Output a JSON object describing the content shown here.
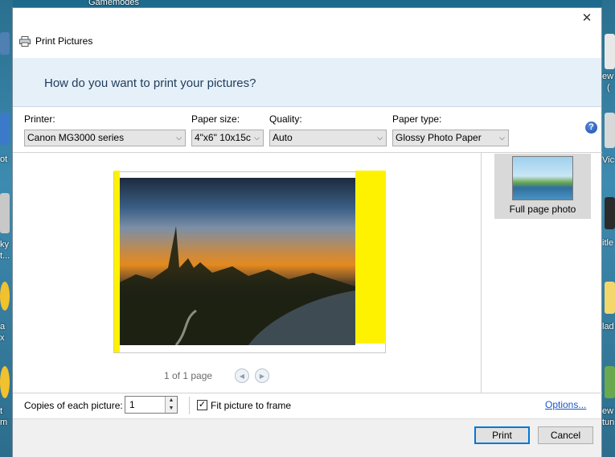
{
  "desktop": {
    "top_label": "Gamemodes",
    "left_labels": [
      "ot",
      "ky",
      "t...",
      "a",
      "x",
      "t",
      "m"
    ],
    "right_labels": [
      "ew",
      "(",
      "Vic",
      "itle",
      "lad",
      "ew",
      "tun"
    ]
  },
  "dialog": {
    "title": "Print Pictures",
    "close_glyph": "✕",
    "question": "How do you want to print your pictures?",
    "printer": {
      "label": "Printer:",
      "value": "Canon MG3000 series"
    },
    "paper_size": {
      "label": "Paper size:",
      "value": "4\"x6\" 10x15c"
    },
    "quality": {
      "label": "Quality:",
      "value": "Auto"
    },
    "paper_type": {
      "label": "Paper type:",
      "value": "Glossy Photo Paper"
    },
    "help_glyph": "?",
    "page_indicator": "1 of 1 page",
    "prev_glyph": "◀",
    "next_glyph": "▶",
    "layout_option": "Full page photo",
    "copies_label": "Copies of each picture:",
    "copies_value": "1",
    "spin_up": "▲",
    "spin_down": "▼",
    "fit_label": "Fit picture to frame",
    "fit_checked": "✓",
    "options_link": "Options...",
    "print_button": "Print",
    "cancel_button": "Cancel",
    "combo_arrow": "⌵"
  },
  "colors": {
    "banner": "#e6f0f9",
    "highlight": "#fff200",
    "link": "#1a56c8",
    "accent": "#0078d7"
  }
}
